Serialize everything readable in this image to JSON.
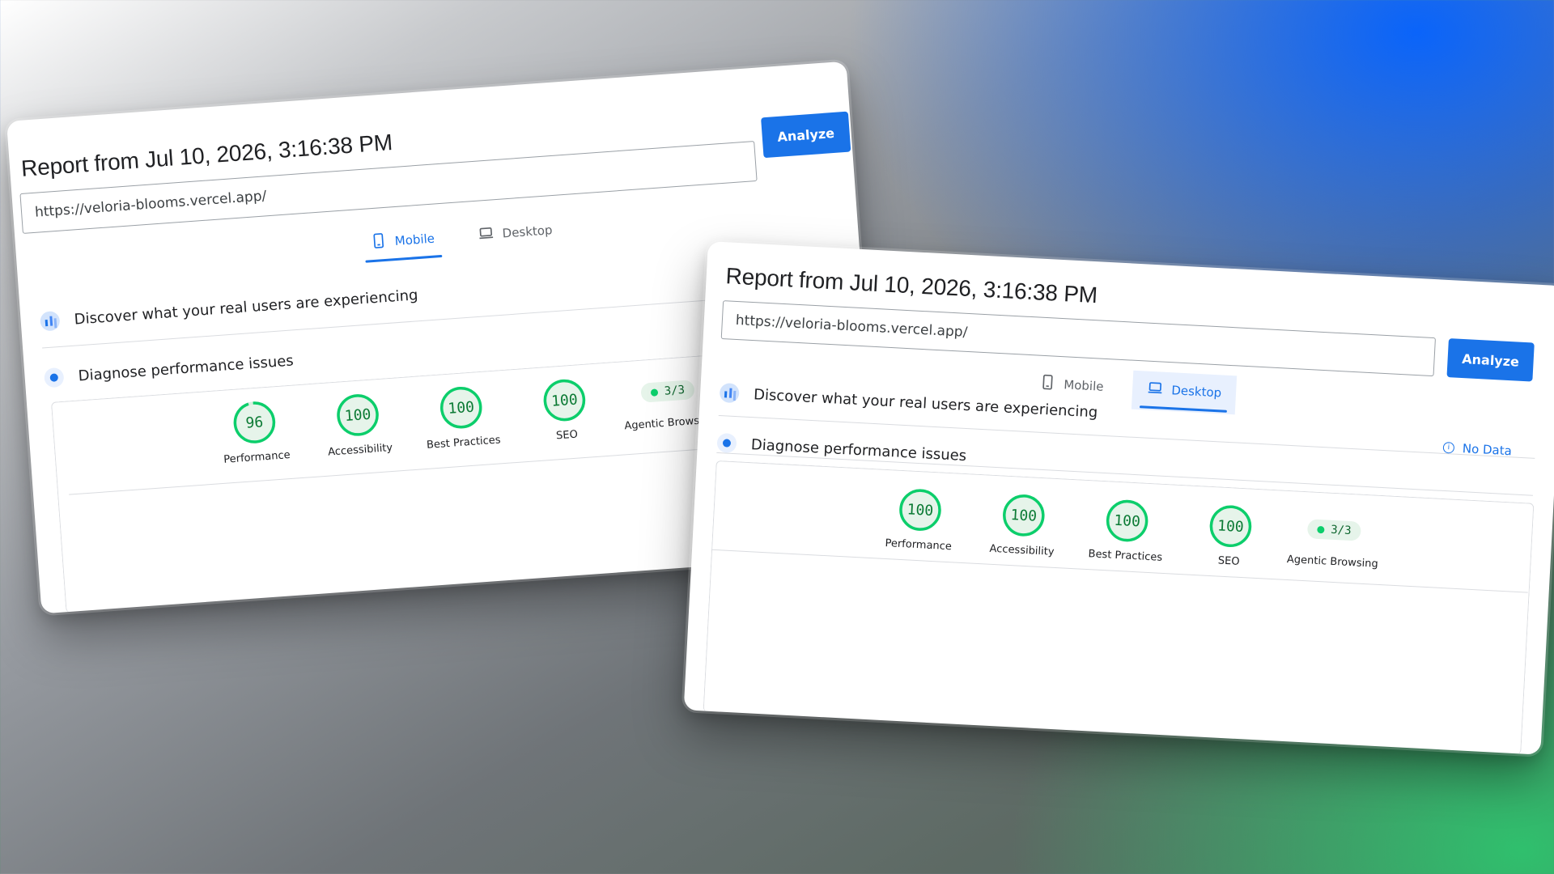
{
  "mobile_report": {
    "title": "Report from Jul 10, 2026, 3:16:38 PM",
    "url_value": "https://veloria-blooms.vercel.app/",
    "analyze_label": "Analyze",
    "tabs": [
      {
        "label": "Mobile",
        "icon": "phone-icon",
        "active": true
      },
      {
        "label": "Desktop",
        "icon": "laptop-icon",
        "active": false
      }
    ],
    "crux_heading": "Discover what your real users are experiencing",
    "diagnose_heading": "Diagnose performance issues",
    "scores": [
      {
        "label": "Performance",
        "value": "96",
        "fraction": 0.96
      },
      {
        "label": "Accessibility",
        "value": "100",
        "fraction": 1
      },
      {
        "label": "Best Practices",
        "value": "100",
        "fraction": 1
      },
      {
        "label": "SEO",
        "value": "100",
        "fraction": 1
      }
    ],
    "agentic": {
      "label": "Agentic Browsing",
      "value": "3/3"
    }
  },
  "desktop_report": {
    "title": "Report from Jul 10, 2026, 3:16:38 PM",
    "url_value": "https://veloria-blooms.vercel.app/",
    "analyze_label": "Analyze",
    "tabs": [
      {
        "label": "Mobile",
        "icon": "phone-icon",
        "active": false
      },
      {
        "label": "Desktop",
        "icon": "laptop-icon",
        "active": true
      }
    ],
    "crux_heading": "Discover what your real users are experiencing",
    "diagnose_heading": "Diagnose performance issues",
    "no_data_label": "No Data",
    "scores": [
      {
        "label": "Performance",
        "value": "100",
        "fraction": 1
      },
      {
        "label": "Accessibility",
        "value": "100",
        "fraction": 1
      },
      {
        "label": "Best Practices",
        "value": "100",
        "fraction": 1
      },
      {
        "label": "SEO",
        "value": "100",
        "fraction": 1
      }
    ],
    "agentic": {
      "label": "Agentic Browsing",
      "value": "3/3"
    }
  },
  "colors": {
    "accent": "#1a73e8",
    "score_pass": "#0cce6b",
    "score_text": "#0b7a34",
    "score_track": "#e6f4ea"
  }
}
